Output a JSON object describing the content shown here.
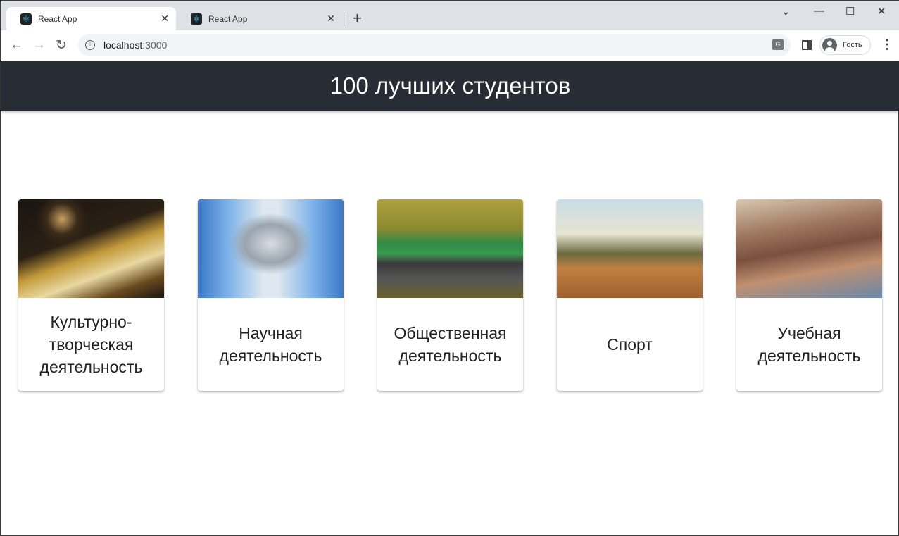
{
  "browser": {
    "tabs": [
      {
        "title": "React App",
        "active": true
      },
      {
        "title": "React App",
        "active": false
      }
    ],
    "url_host": "localhost",
    "url_port": ":3000",
    "profile_label": "Гость"
  },
  "header": {
    "title": "100 лучших студентов",
    "background": "#282c34"
  },
  "categories": [
    {
      "label": "Культурно-творческая деятельность",
      "image": "theatre-building-fireworks"
    },
    {
      "label": "Научная деятельность",
      "image": "microscope"
    },
    {
      "label": "Общественная деятельность",
      "image": "volunteers-cleanup"
    },
    {
      "label": "Спорт",
      "image": "runners"
    },
    {
      "label": "Учебная деятельность",
      "image": "students-lecture-hall"
    }
  ]
}
